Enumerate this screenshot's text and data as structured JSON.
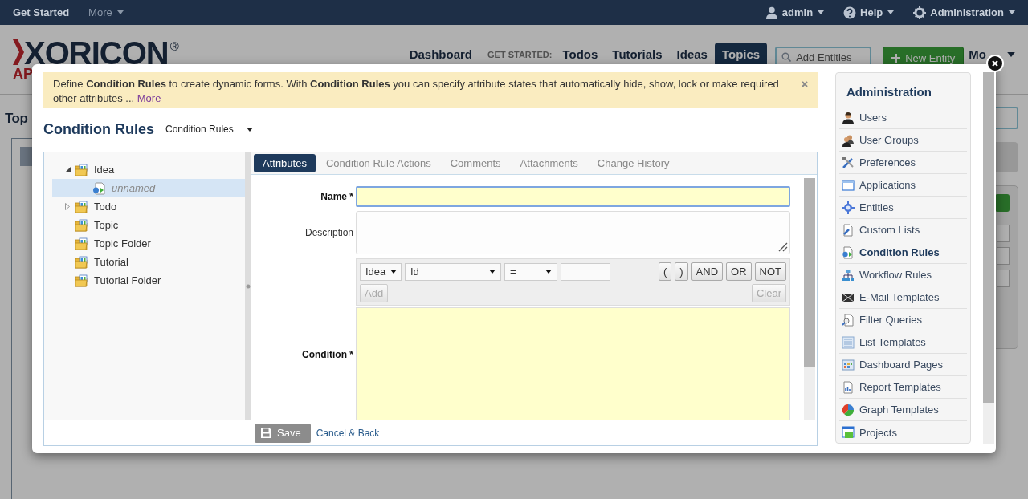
{
  "top_bar": {
    "left": [
      {
        "label": "Get Started",
        "has_menu": false
      },
      {
        "label": "More",
        "has_menu": true
      }
    ],
    "right": [
      {
        "label": "admin"
      },
      {
        "label": "Help"
      },
      {
        "label": "Administration"
      }
    ]
  },
  "header": {
    "logo": {
      "name": "XORICON",
      "mark": "®",
      "sub": "AP"
    },
    "nav": [
      {
        "label": "Dashboard",
        "kind": "link",
        "selected": false
      },
      {
        "label": "GET STARTED:",
        "kind": "heading"
      },
      {
        "label": "Todos",
        "kind": "link",
        "selected": false
      },
      {
        "label": "Tutorials",
        "kind": "link",
        "selected": false
      },
      {
        "label": "Ideas",
        "kind": "link",
        "selected": false
      },
      {
        "label": "Topics",
        "kind": "link",
        "selected": true
      }
    ],
    "search": {
      "placeholder": "Add Entities"
    },
    "new_button": "New Entity",
    "more_menu": "Mo"
  },
  "page": {
    "heading": "Top"
  },
  "dialog": {
    "notice": {
      "text": "Define **Condition Rules** to create dynamic forms. With **Condition Rules** you can specify attribute states that automatically hide, show, lock or make required other attributes ...",
      "link": "More"
    },
    "title": "Condition Rules",
    "view_select": "Condition Rules",
    "tree": [
      {
        "label": "Idea",
        "kind": "folder",
        "expanded": true,
        "selected": false,
        "children": [
          {
            "label": "unnamed",
            "kind": "rule",
            "selected": true
          }
        ]
      },
      {
        "label": "Todo",
        "kind": "folder",
        "expanded": false,
        "selected": false
      },
      {
        "label": "Topic",
        "kind": "folder",
        "selected": false
      },
      {
        "label": "Topic Folder",
        "kind": "folder",
        "selected": false
      },
      {
        "label": "Tutorial",
        "kind": "folder",
        "selected": false
      },
      {
        "label": "Tutorial Folder",
        "kind": "folder",
        "selected": false
      }
    ],
    "tabs": [
      {
        "label": "Attributes",
        "selected": true
      },
      {
        "label": "Condition Rule Actions",
        "selected": false
      },
      {
        "label": "Comments",
        "selected": false
      },
      {
        "label": "Attachments",
        "selected": false
      },
      {
        "label": "Change History",
        "selected": false
      }
    ],
    "form": {
      "name": {
        "label": "Name *",
        "required": true,
        "focused": true
      },
      "description": {
        "label": "Description",
        "required": false
      },
      "condition": {
        "label": "Condition *",
        "required": true,
        "builder": {
          "entity": "Idea",
          "attribute": "Id",
          "operator": "=",
          "operators": [
            {
              "label": "(",
              "disabled": false
            },
            {
              "label": ")",
              "disabled": false
            },
            {
              "label": "AND",
              "disabled": false
            },
            {
              "label": "OR",
              "disabled": false
            },
            {
              "label": "NOT",
              "disabled": false
            }
          ],
          "add": {
            "label": "Add",
            "disabled": true
          },
          "clear": {
            "label": "Clear",
            "disabled": true
          }
        }
      }
    },
    "footer": {
      "save": "Save",
      "cancel": "Cancel & Back"
    },
    "admin": {
      "heading": "Administration",
      "items": [
        {
          "label": "Users",
          "selected": false
        },
        {
          "label": "User Groups",
          "selected": false
        },
        {
          "label": "Preferences",
          "selected": false
        },
        {
          "label": "Applications",
          "selected": false
        },
        {
          "label": "Entities",
          "selected": false
        },
        {
          "label": "Custom Lists",
          "selected": false
        },
        {
          "label": "Condition Rules",
          "selected": true
        },
        {
          "label": "Workflow Rules",
          "selected": false
        },
        {
          "label": "E-Mail Templates",
          "selected": false
        },
        {
          "label": "Filter Queries",
          "selected": false
        },
        {
          "label": "List Templates",
          "selected": false
        },
        {
          "label": "Dashboard Pages",
          "selected": false
        },
        {
          "label": "Report Templates",
          "selected": false
        },
        {
          "label": "Graph Templates",
          "selected": false
        },
        {
          "label": "Projects",
          "selected": false
        }
      ]
    }
  }
}
